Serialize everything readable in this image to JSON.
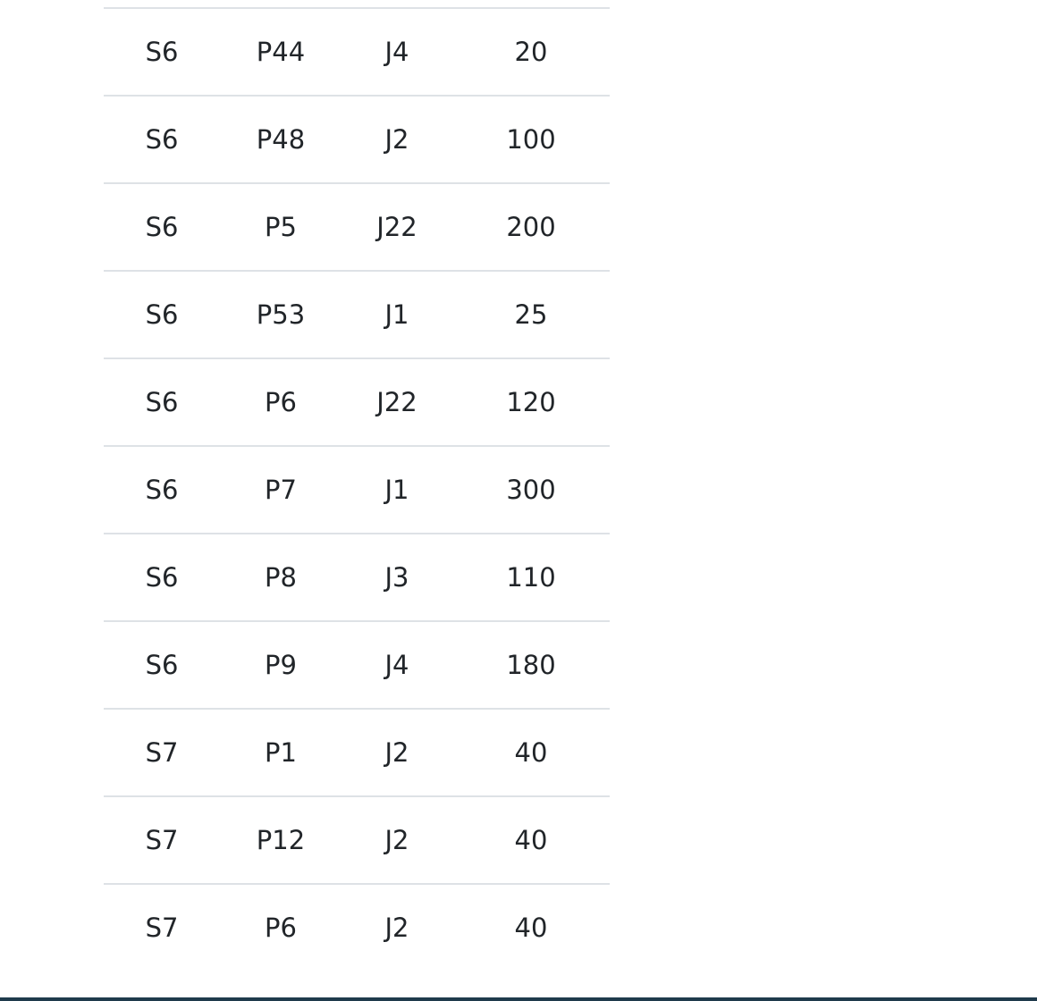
{
  "table": {
    "rows": [
      [
        "S6",
        "P44",
        "J4",
        "20"
      ],
      [
        "S6",
        "P48",
        "J2",
        "100"
      ],
      [
        "S6",
        "P5",
        "J22",
        "200"
      ],
      [
        "S6",
        "P53",
        "J1",
        "25"
      ],
      [
        "S6",
        "P6",
        "J22",
        "120"
      ],
      [
        "S6",
        "P7",
        "J1",
        "300"
      ],
      [
        "S6",
        "P8",
        "J3",
        "110"
      ],
      [
        "S6",
        "P9",
        "J4",
        "180"
      ],
      [
        "S7",
        "P1",
        "J2",
        "40"
      ],
      [
        "S7",
        "P12",
        "J2",
        "40"
      ],
      [
        "S7",
        "P6",
        "J2",
        "40"
      ]
    ]
  },
  "colors": {
    "text": "#212529",
    "row_border": "#dee2e6",
    "bottom_bar": "#1f3a4c"
  }
}
